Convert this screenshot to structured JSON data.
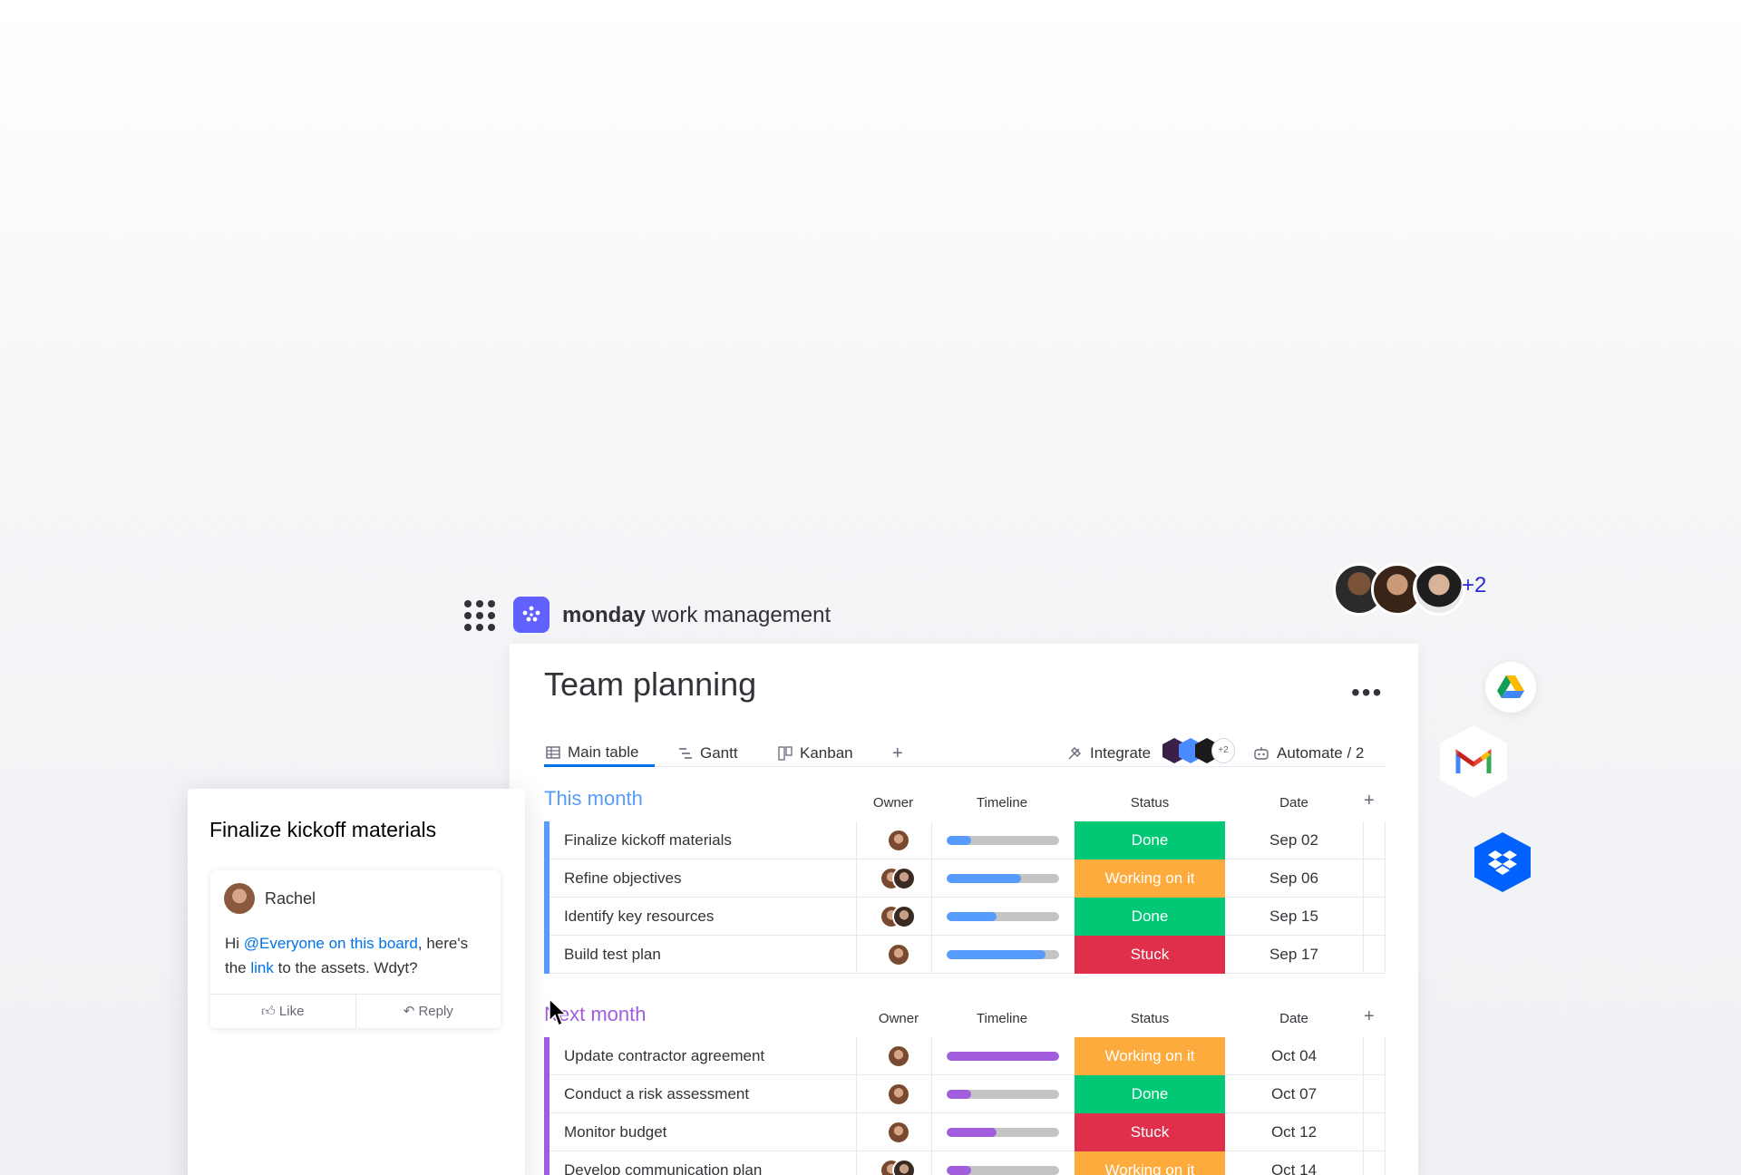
{
  "app": {
    "brand_bold": "monday",
    "brand_rest": " work management"
  },
  "collaborators": {
    "extra_count": "+2"
  },
  "board": {
    "title": "Team planning",
    "more": "•••",
    "tabs": [
      {
        "label": "Main table",
        "icon": "table-icon",
        "active": true
      },
      {
        "label": "Gantt",
        "icon": "gantt-icon",
        "active": false
      },
      {
        "label": "Kanban",
        "icon": "kanban-icon",
        "active": false
      }
    ],
    "add_tab": "+",
    "integrate_label": "Integrate",
    "integrate_extra": "+2",
    "automate_label": "Automate / 2"
  },
  "columns": {
    "owner": "Owner",
    "timeline": "Timeline",
    "status": "Status",
    "date": "Date",
    "add": "+"
  },
  "groups": [
    {
      "title": "This month",
      "color": "#579bfc",
      "rows": [
        {
          "name": "Finalize kickoff materials",
          "timeline": 0.22,
          "status": "Done",
          "status_color": "#00c875",
          "date": "Sep 02",
          "owners": 1
        },
        {
          "name": "Refine objectives",
          "timeline": 0.66,
          "status": "Working on it",
          "status_color": "#fdab3d",
          "date": "Sep 06",
          "owners": 2
        },
        {
          "name": "Identify key resources",
          "timeline": 0.44,
          "status": "Done",
          "status_color": "#00c875",
          "date": "Sep 15",
          "owners": 2
        },
        {
          "name": "Build test plan",
          "timeline": 0.88,
          "status": "Stuck",
          "status_color": "#df2f4a",
          "date": "Sep 17",
          "owners": 1
        }
      ]
    },
    {
      "title": "Next month",
      "color": "#a25ddc",
      "rows": [
        {
          "name": "Update contractor agreement",
          "timeline": 1.0,
          "status": "Working on it",
          "status_color": "#fdab3d",
          "date": "Oct 04",
          "owners": 1
        },
        {
          "name": "Conduct a risk assessment",
          "timeline": 0.22,
          "status": "Done",
          "status_color": "#00c875",
          "date": "Oct 07",
          "owners": 1
        },
        {
          "name": "Monitor budget",
          "timeline": 0.44,
          "status": "Stuck",
          "status_color": "#df2f4a",
          "date": "Oct 12",
          "owners": 1
        },
        {
          "name": "Develop communication plan",
          "timeline": 0.22,
          "status": "Working on it",
          "status_color": "#fdab3d",
          "date": "Oct 14",
          "owners": 2
        }
      ]
    }
  ],
  "comment_card": {
    "title": "Finalize kickoff materials",
    "author": "Rachel",
    "text_pre": "Hi ",
    "mention": "@Everyone on this board",
    "text_mid": ", here's the ",
    "link": "link",
    "text_post": " to the assets. Wdyt?",
    "like_label": "Like",
    "reply_label": "Reply"
  },
  "side_apps": [
    "google-drive-icon",
    "gmail-icon",
    "dropbox-icon"
  ]
}
